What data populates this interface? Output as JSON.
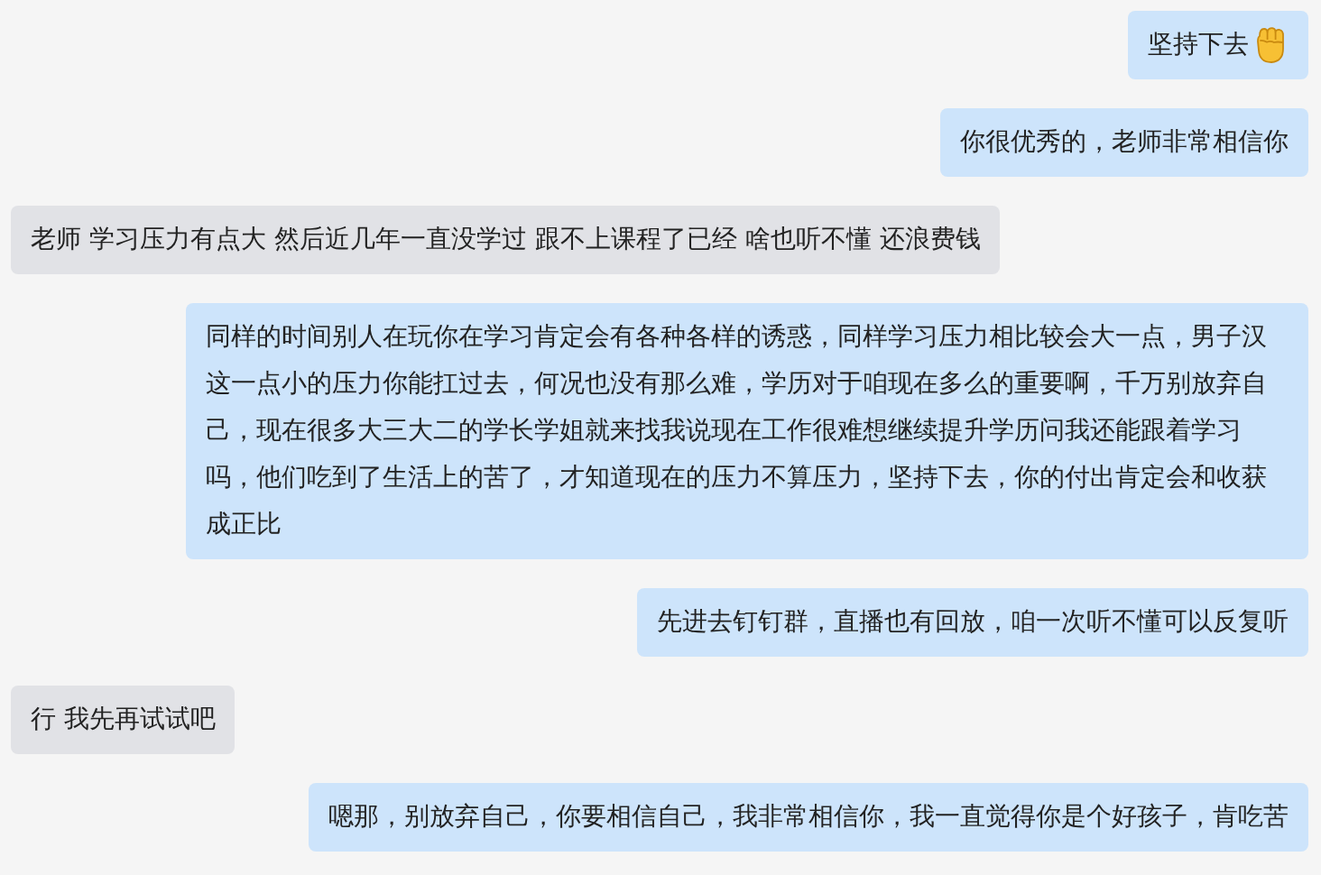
{
  "messages": [
    {
      "kind": "outgoing",
      "text": "坚持下去",
      "emoji": true
    },
    {
      "kind": "outgoing",
      "text": "你很优秀的，老师非常相信你"
    },
    {
      "kind": "incoming",
      "text": "老师 学习压力有点大 然后近几年一直没学过 跟不上课程了已经 啥也听不懂 还浪费钱"
    },
    {
      "kind": "outgoing",
      "text": "同样的时间别人在玩你在学习肯定会有各种各样的诱惑，同样学习压力相比较会大一点，男子汉这一点小的压力你能扛过去，何况也没有那么难，学历对于咱现在多么的重要啊，千万别放弃自己，现在很多大三大二的学长学姐就来找我说现在工作很难想继续提升学历问我还能跟着学习吗，他们吃到了生活上的苦了，才知道现在的压力不算压力，坚持下去，你的付出肯定会和收获成正比"
    },
    {
      "kind": "outgoing",
      "text": "先进去钉钉群，直播也有回放，咱一次听不懂可以反复听"
    },
    {
      "kind": "incoming",
      "text": "行 我先再试试吧"
    },
    {
      "kind": "outgoing",
      "text": "嗯那，别放弃自己，你要相信自己，我非常相信你，我一直觉得你是个好孩子，肯吃苦"
    }
  ]
}
